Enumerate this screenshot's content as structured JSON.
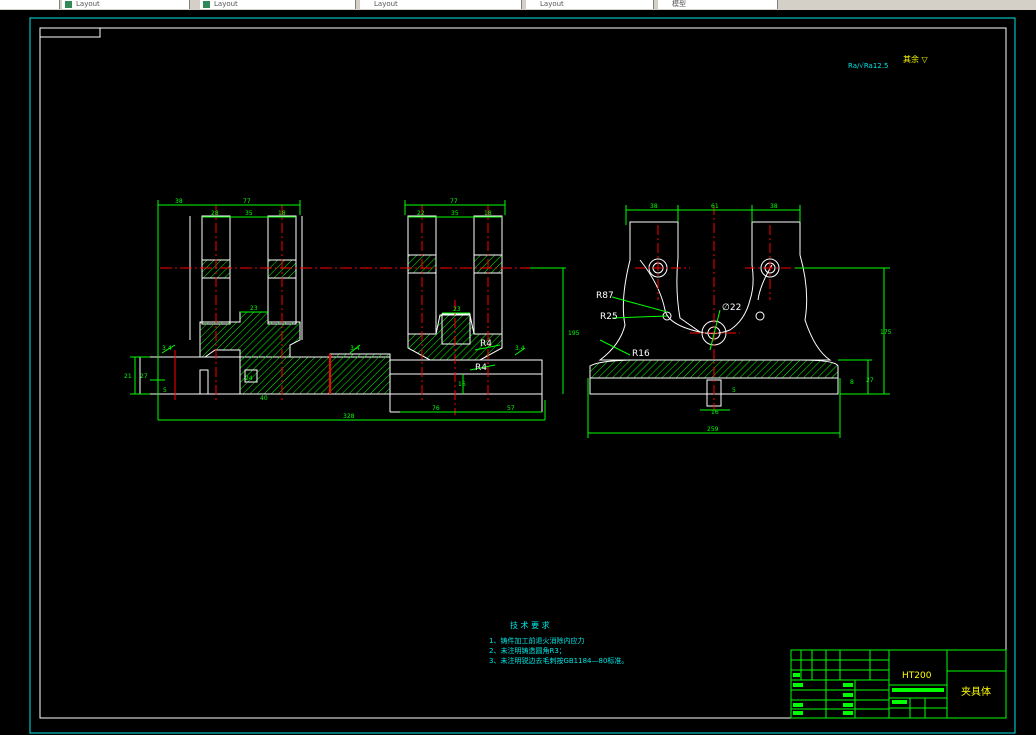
{
  "tabs": [
    {
      "label": ""
    },
    {
      "label": "Layout"
    },
    {
      "label": "Layout"
    },
    {
      "label": "Layout"
    },
    {
      "label": "Layout"
    },
    {
      "label": "模型"
    }
  ],
  "colors": {
    "background": "#000000",
    "frame": "#ffffff",
    "geometry": "#ffffff",
    "dimensions": "#00ff00",
    "centerlines": "#ff0000",
    "hatch": "#00ff00",
    "title_block": "#00ff00",
    "text": "#ffff00",
    "roughness": "#00ffff"
  },
  "roughness": {
    "left": "Ra/√Ra12.5",
    "right": "其余 ▽"
  },
  "front_view": {
    "dims": {
      "d38": "38",
      "d77a": "77",
      "d77b": "77",
      "d28": "28",
      "d35a": "35",
      "d18": "18",
      "d22": "22",
      "d35b": "35",
      "d18b": "18",
      "d23a": "23",
      "d23b": "23",
      "d195": "195",
      "d21": "21",
      "d27": "27",
      "d5": "5",
      "d24": "24",
      "d40": "40",
      "d328": "328",
      "d76": "76",
      "d57": "57",
      "d16": "16",
      "d34a": "3.4",
      "d34b": "3.4",
      "d34c": "3.4",
      "r4a": "R4",
      "r4b": "R4"
    }
  },
  "side_view": {
    "dims": {
      "d38a": "38",
      "d61": "61",
      "d38b": "38",
      "r87": "R87",
      "r25": "R25",
      "d22": "∅22",
      "r16": "R16",
      "d175": "175",
      "d27": "27",
      "d8": "8",
      "d16": "16",
      "d259": "259",
      "d5": "5"
    }
  },
  "tech_req": {
    "title": "技 术 要 求",
    "line1": "1、铸件加工前退火消除内应力",
    "line2": "2、未注明铸造圆角R3；",
    "line3": "3、未注明锐边去毛刺按GB1184—80标准。"
  },
  "title_block": {
    "material": "HT200",
    "part_name": "夹具体"
  }
}
